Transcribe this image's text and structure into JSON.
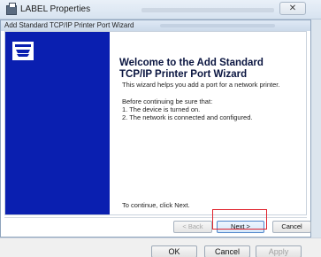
{
  "parent_window": {
    "title": "LABEL Properties",
    "close_glyph": "✕",
    "buttons": {
      "ok": "OK",
      "cancel": "Cancel",
      "apply": "Apply"
    }
  },
  "wizard": {
    "title": "Add Standard TCP/IP Printer Port Wizard",
    "heading": "Welcome to the Add Standard\nTCP/IP Printer Port Wizard",
    "intro": "This wizard helps you add a port for a network printer.",
    "prereq_heading": "Before continuing be sure that:",
    "prereq_list": "1.  The device is turned on.\n2.  The network is connected and configured.",
    "continue_hint": "To continue, click Next.",
    "buttons": {
      "back": "< Back",
      "next": "Next >",
      "cancel": "Cancel"
    }
  },
  "colors": {
    "side_panel": "#0a1fb0",
    "highlight": "#e0242e"
  },
  "icons": [
    "printer-icon",
    "app-icon"
  ]
}
